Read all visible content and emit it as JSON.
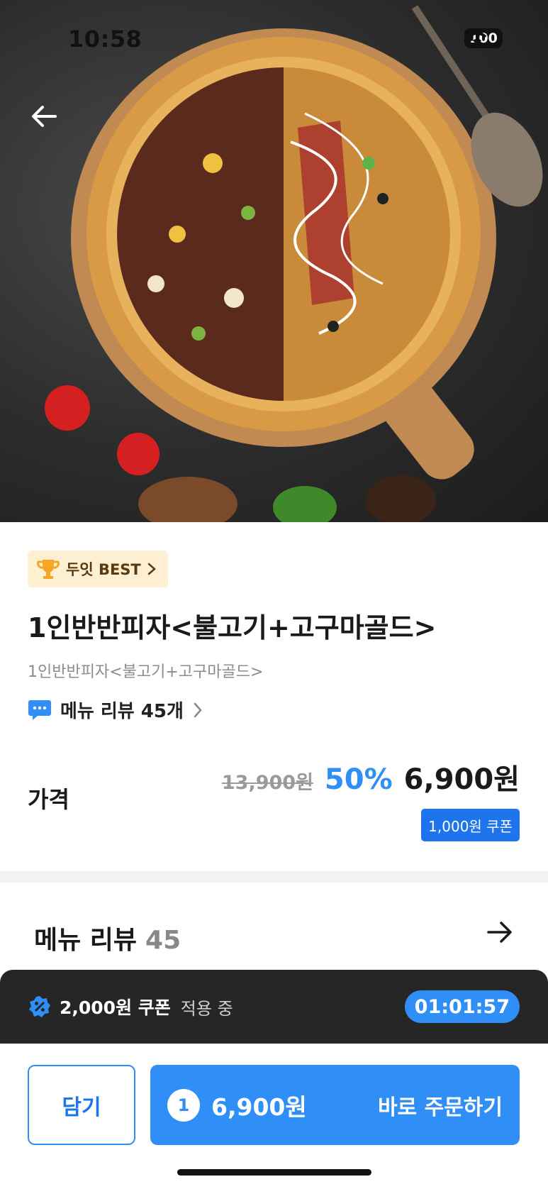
{
  "status_bar": {
    "time": "10:58",
    "battery": "100"
  },
  "hero": {
    "image": "pizza-image"
  },
  "badge": {
    "label": "두잇 BEST"
  },
  "product": {
    "title": "1인반반피자<불고기+고구마골드>",
    "subtitle": "1인반반피자<불고기+고구마골드>"
  },
  "review_link": {
    "label": "메뉴 리뷰 45개"
  },
  "price": {
    "label": "가격",
    "original": "13,900원",
    "discount": "50%",
    "final": "6,900원",
    "coupon": "1,000원 쿠폰"
  },
  "review_section": {
    "title": "메뉴 리뷰",
    "count": "45"
  },
  "coupon_bar": {
    "amount": "2,000원 쿠폰",
    "status": "적용 중",
    "timer": "01:01:57"
  },
  "actions": {
    "cart_label": "담기",
    "quantity": "1",
    "order_price": "6,900원",
    "order_label": "바로 주문하기"
  },
  "colors": {
    "accent": "#2f8ff6",
    "coupon_blue": "#1e74ec",
    "dark_bar": "#262626",
    "badge_bg": "#fdf0d2"
  }
}
